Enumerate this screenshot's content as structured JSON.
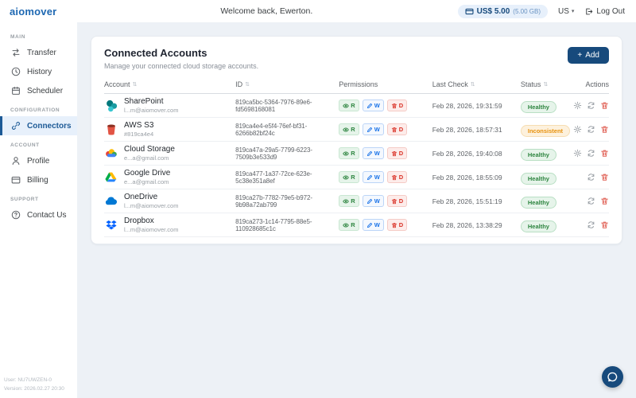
{
  "topbar": {
    "logo": "aiomover",
    "welcome": "Welcome back, Ewerton.",
    "balance": {
      "amount": "US$ 5.00",
      "quota": "(5.00 GB)"
    },
    "language": "US",
    "logout_label": "Log Out"
  },
  "sidebar": {
    "sections": [
      {
        "label": "MAIN",
        "items": [
          {
            "label": "Transfer",
            "icon": "transfer-icon",
            "active": false
          },
          {
            "label": "History",
            "icon": "history-icon",
            "active": false
          },
          {
            "label": "Scheduler",
            "icon": "scheduler-icon",
            "active": false
          }
        ]
      },
      {
        "label": "CONFIGURATION",
        "items": [
          {
            "label": "Connectors",
            "icon": "connectors-icon",
            "active": true
          }
        ]
      },
      {
        "label": "ACCOUNT",
        "items": [
          {
            "label": "Profile",
            "icon": "profile-icon",
            "active": false
          },
          {
            "label": "Billing",
            "icon": "billing-icon",
            "active": false
          }
        ]
      },
      {
        "label": "SUPPORT",
        "items": [
          {
            "label": "Contact Us",
            "icon": "contact-icon",
            "active": false
          }
        ]
      }
    ],
    "footer": {
      "user": "User: NU7UWZEN-0",
      "version": "Version: 2026.02.27 20:30"
    }
  },
  "main": {
    "title": "Connected Accounts",
    "subtitle": "Manage your connected cloud storage accounts.",
    "add_button": {
      "plus": "+",
      "label": "Add"
    },
    "columns": [
      {
        "key": "account",
        "label": "Account",
        "sortable": true
      },
      {
        "key": "id",
        "label": "ID",
        "sortable": true
      },
      {
        "key": "perm",
        "label": "Permissions",
        "sortable": false
      },
      {
        "key": "check",
        "label": "Last Check",
        "sortable": true
      },
      {
        "key": "status",
        "label": "Status",
        "sortable": true
      },
      {
        "key": "actions",
        "label": "Actions",
        "sortable": false
      }
    ],
    "permission_badges": [
      {
        "key": "read",
        "label": "R",
        "icon": "eye-icon"
      },
      {
        "key": "write",
        "label": "W",
        "icon": "pencil-icon"
      },
      {
        "key": "delete",
        "label": "D",
        "icon": "trash-icon"
      }
    ],
    "rows": [
      {
        "icon": "sharepoint-icon",
        "name": "SharePoint",
        "sub": "l...m@aiomover.com",
        "id": "819ca5bc-5364-7976-89e6-fd5698168081",
        "last_check": "Feb 28, 2026, 19:31:59",
        "status": "Healthy",
        "status_type": "healthy",
        "actions": [
          "settings-icon",
          "refresh-icon",
          "delete-icon"
        ]
      },
      {
        "icon": "aws-s3-icon",
        "name": "AWS S3",
        "sub": "#819ca4e4",
        "id": "819ca4e4-e5f4-76ef-bf31-6266b82bf24c",
        "last_check": "Feb 28, 2026, 18:57:31",
        "status": "Inconsistent",
        "status_type": "warning",
        "actions": [
          "settings-icon",
          "refresh-icon",
          "delete-icon"
        ]
      },
      {
        "icon": "cloud-storage-icon",
        "name": "Cloud Storage",
        "sub": "e...a@gmail.com",
        "id": "819ca47a-29a5-7799-6223-7509b3e533d9",
        "last_check": "Feb 28, 2026, 19:40:08",
        "status": "Healthy",
        "status_type": "healthy",
        "actions": [
          "settings-icon",
          "refresh-icon",
          "delete-icon"
        ]
      },
      {
        "icon": "google-drive-icon",
        "name": "Google Drive",
        "sub": "e...a@gmail.com",
        "id": "819ca477-1a37-72ce-623e-5c38e351a8ef",
        "last_check": "Feb 28, 2026, 18:55:09",
        "status": "Healthy",
        "status_type": "healthy",
        "actions": [
          "refresh-icon",
          "delete-icon"
        ]
      },
      {
        "icon": "onedrive-icon",
        "name": "OneDrive",
        "sub": "l...m@aiomover.com",
        "id": "819ca27b-7782-79e5-b972-9b98a72ab799",
        "last_check": "Feb 28, 2026, 15:51:19",
        "status": "Healthy",
        "status_type": "healthy",
        "actions": [
          "refresh-icon",
          "delete-icon"
        ]
      },
      {
        "icon": "dropbox-icon",
        "name": "Dropbox",
        "sub": "l...m@aiomover.com",
        "id": "819ca273-1c14-7795-88e5-110928685c1c",
        "last_check": "Feb 28, 2026, 13:38:29",
        "status": "Healthy",
        "status_type": "healthy",
        "actions": [
          "refresh-icon",
          "delete-icon"
        ]
      }
    ]
  },
  "colors": {
    "accent_blue": "#1d5a96",
    "button_navy": "#174a7c",
    "healthy_green": "#2e8540",
    "warning_orange": "#e8910c",
    "delete_red": "#d93025",
    "write_blue": "#1a73e8"
  }
}
